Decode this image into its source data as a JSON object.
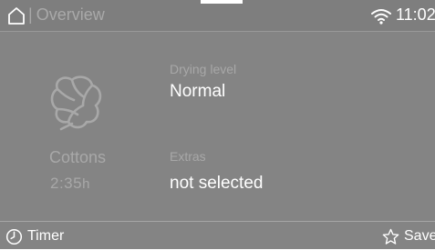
{
  "header": {
    "title": "Overview",
    "separator": "|",
    "time": "11:02",
    "home_icon": "home-icon",
    "wifi_icon": "wifi-icon"
  },
  "program": {
    "icon": "cotton-boll-icon",
    "name": "Cottons",
    "duration": "2:35",
    "duration_unit": "h"
  },
  "settings": {
    "drying_level_label": "Drying level",
    "drying_level_value": "Normal",
    "extras_label": "Extras",
    "extras_value": "not selected"
  },
  "footer": {
    "timer_label": "Timer",
    "timer_icon": "clock-icon",
    "save_label": "Save",
    "save_icon": "star-icon"
  },
  "colors": {
    "screen_bg": "#848484",
    "primary_text": "#ffffff",
    "secondary_text": "#a8a8a8"
  }
}
